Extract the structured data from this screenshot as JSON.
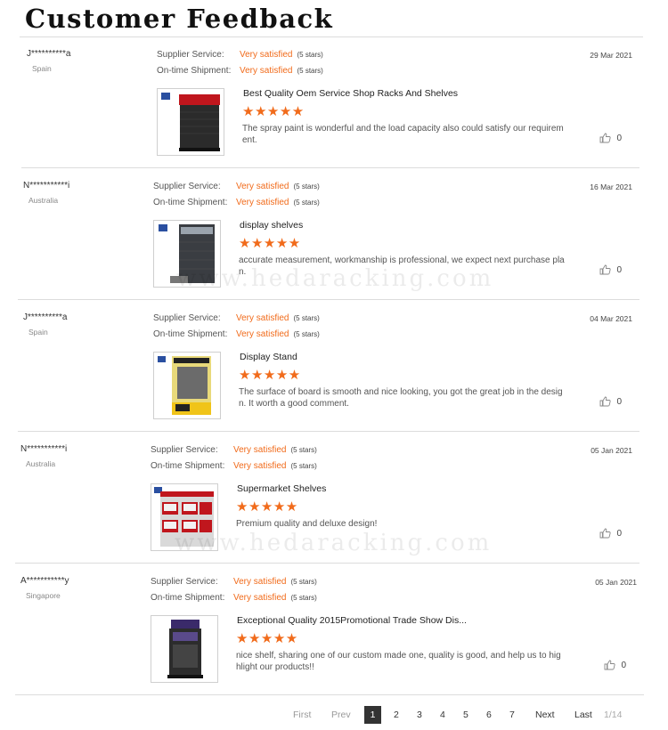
{
  "page": {
    "title": "Customer Feedback"
  },
  "labels": {
    "supplier_service": "Supplier Service:",
    "ontime_shipment": "On-time Shipment:"
  },
  "watermark": "www.hedaracking.com",
  "reviews": [
    {
      "reviewer": "J**********a",
      "country": "Spain",
      "date": "29 Mar 2021",
      "supplier_service": "Very satisfied",
      "supplier_stars": "(5 stars)",
      "shipment": "Very satisfied",
      "shipment_stars": "(5 stars)",
      "product_title": "Best Quality Oem Service Shop Racks And Shelves",
      "rating": "★★★★★",
      "comment": "The spray paint is wonderful and the load capacity also could satisfy our requirement.",
      "likes": "0"
    },
    {
      "reviewer": "N***********i",
      "country": "Australia",
      "date": "16 Mar 2021",
      "supplier_service": "Very satisfied",
      "supplier_stars": "(5 stars)",
      "shipment": "Very satisfied",
      "shipment_stars": "(5 stars)",
      "product_title": "display shelves",
      "rating": "★★★★★",
      "comment": "accurate measurement, workmanship is professional, we expect next purchase plan.",
      "likes": "0"
    },
    {
      "reviewer": "J**********a",
      "country": "Spain",
      "date": "04 Mar 2021",
      "supplier_service": "Very satisfied",
      "supplier_stars": "(5 stars)",
      "shipment": "Very satisfied",
      "shipment_stars": "(5 stars)",
      "product_title": "Display Stand",
      "rating": "★★★★★",
      "comment": "The surface of board is smooth and nice looking, you got the great job in the design. It worth a good comment.",
      "likes": "0"
    },
    {
      "reviewer": "N***********i",
      "country": "Australia",
      "date": "05 Jan 2021",
      "supplier_service": "Very satisfied",
      "supplier_stars": "(5 stars)",
      "shipment": "Very satisfied",
      "shipment_stars": "(5 stars)",
      "product_title": "Supermarket Shelves",
      "rating": "★★★★★",
      "comment": "Premium quality and deluxe design!",
      "likes": "0"
    },
    {
      "reviewer": "A***********y",
      "country": "Singapore",
      "date": "05 Jan 2021",
      "supplier_service": "Very satisfied",
      "supplier_stars": "(5 stars)",
      "shipment": "Very satisfied",
      "shipment_stars": "(5 stars)",
      "product_title": "Exceptional Quality 2015Promotional Trade Show Dis...",
      "rating": "★★★★★",
      "comment": "nice shelf, sharing one of our custom made one, quality is good, and help us to highlight our products!!",
      "likes": "0"
    }
  ],
  "pagination": {
    "first": "First",
    "prev": "Prev",
    "pages": [
      "1",
      "2",
      "3",
      "4",
      "5",
      "6",
      "7"
    ],
    "current": "1",
    "next": "Next",
    "last": "Last",
    "total": "1/14"
  },
  "colors": {
    "accent": "#f16b1b",
    "text": "#333333",
    "divider": "#dcdcdc"
  }
}
